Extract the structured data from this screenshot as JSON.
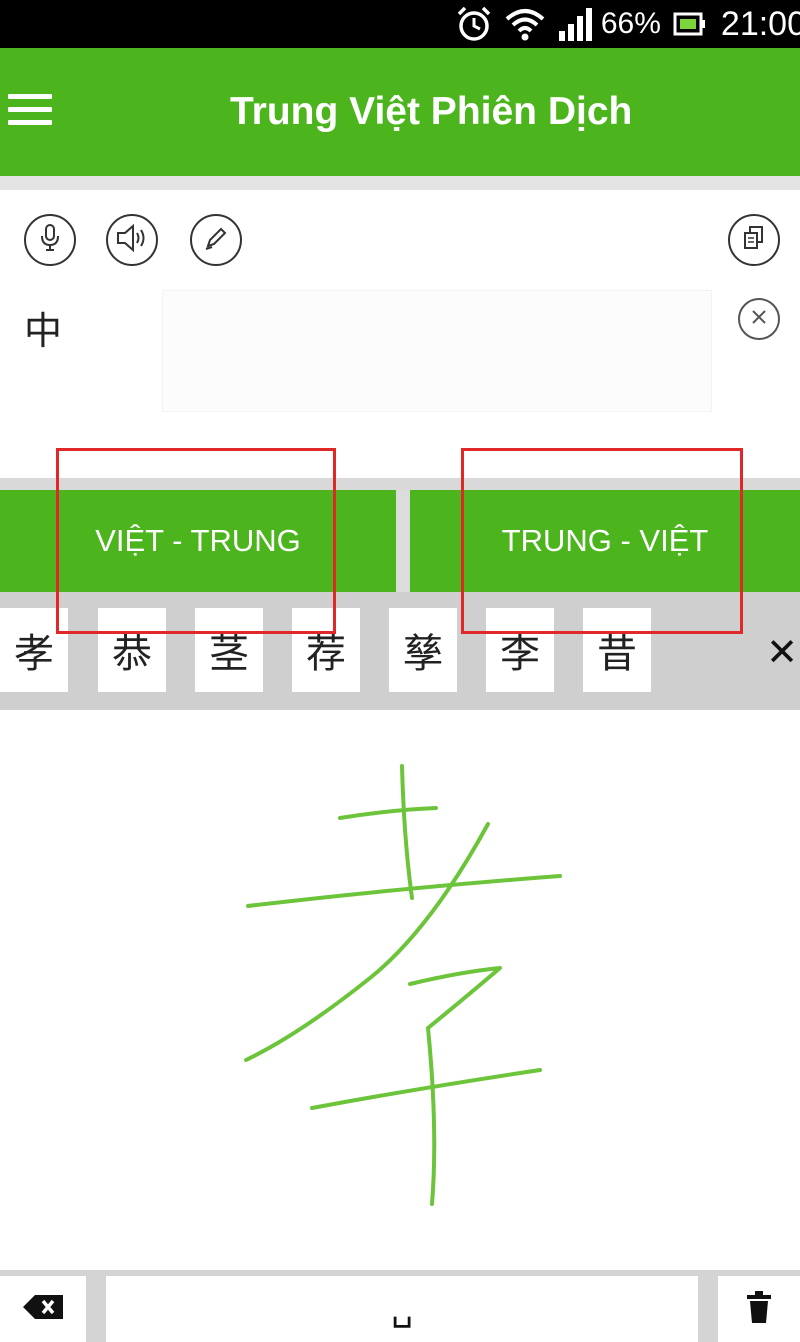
{
  "status_bar": {
    "battery_percent": "66%",
    "time": "21:00",
    "icons": [
      "alarm-icon",
      "wifi-icon",
      "signal-icon",
      "battery-icon"
    ]
  },
  "app_bar": {
    "title": "Trung Việt Phiên Dịch",
    "color": "#4cb51d"
  },
  "toolbar": {
    "icons": [
      "microphone-icon",
      "speaker-icon",
      "pencil-icon",
      "copy-icon"
    ]
  },
  "input": {
    "language_label": "中",
    "value": "",
    "clear_icon": "close-circle-icon"
  },
  "direction_buttons": {
    "viet_trung": "VIỆT - TRUNG",
    "trung_viet": "TRUNG - VIỆT",
    "highlight_color": "#e02828"
  },
  "candidates": {
    "items": [
      "孝",
      "恭",
      "茎",
      "荐",
      "孳",
      "李",
      "昔"
    ],
    "close_label": "✕"
  },
  "handwriting": {
    "stroke_color": "#6cc43a"
  },
  "bottom_keys": {
    "backspace_icon": "backspace-icon",
    "space_label": "␣",
    "delete_icon": "trash-icon"
  }
}
